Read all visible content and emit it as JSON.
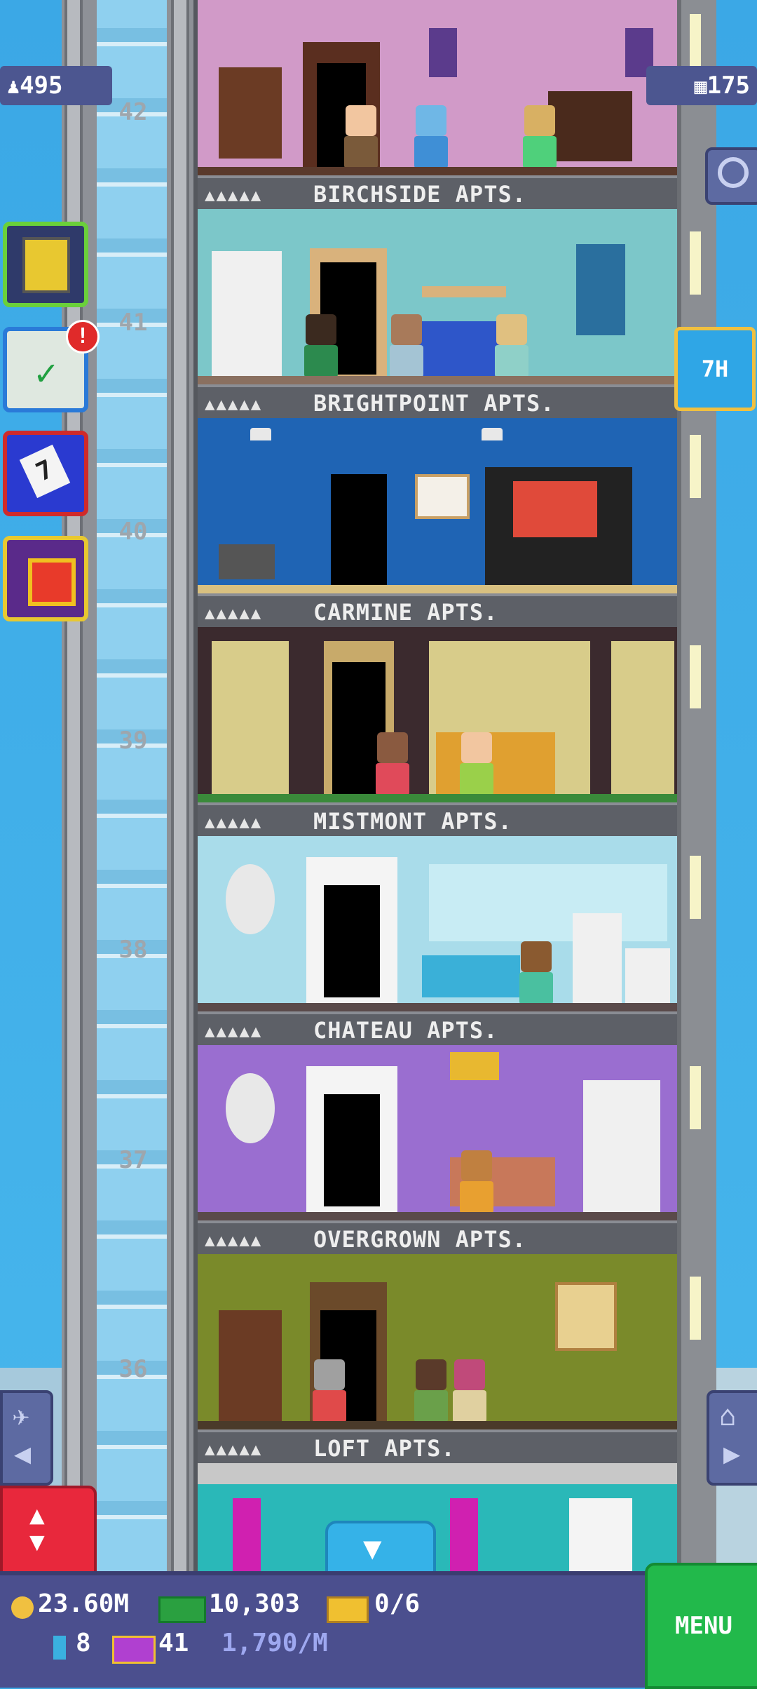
{
  "hud_top": {
    "population": "495",
    "bux": "175",
    "timer": "7H"
  },
  "floors": [
    {
      "number": "42",
      "name": "BIRCHSIDE APTS."
    },
    {
      "number": "41",
      "name": "BRIGHTPOINT APTS."
    },
    {
      "number": "40",
      "name": "CARMINE APTS."
    },
    {
      "number": "39",
      "name": "MISTMONT APTS."
    },
    {
      "number": "38",
      "name": "CHATEAU APTS."
    },
    {
      "number": "37",
      "name": "OVERGROWN APTS."
    },
    {
      "number": "36",
      "name": "LOFT APTS."
    }
  ],
  "resident_marks": "▲▲▲▲▲",
  "badge": "!",
  "calendar_day": "7",
  "bottom_hud": {
    "coins": "23.60M",
    "cash": "10,303",
    "tickets": "0/6",
    "gems": "8",
    "vip": "41",
    "rate": "1,790/M",
    "menu_label": "MENU"
  },
  "colors": {
    "sky": "#3ba8e6",
    "hud": "#4b4f8e",
    "menu": "#22b94b",
    "elevator_button": "#e8283c"
  },
  "icons": [
    "person-icon",
    "building-icon",
    "magnifier-icon",
    "tower-icon",
    "checklist-icon",
    "calendar-icon",
    "gift-icon",
    "elevator-icon",
    "coin-icon",
    "cash-icon",
    "ticket-icon",
    "gem-icon",
    "vip-icon",
    "home-icon",
    "arrow-left-icon",
    "arrow-right-icon",
    "arrow-down-icon"
  ]
}
